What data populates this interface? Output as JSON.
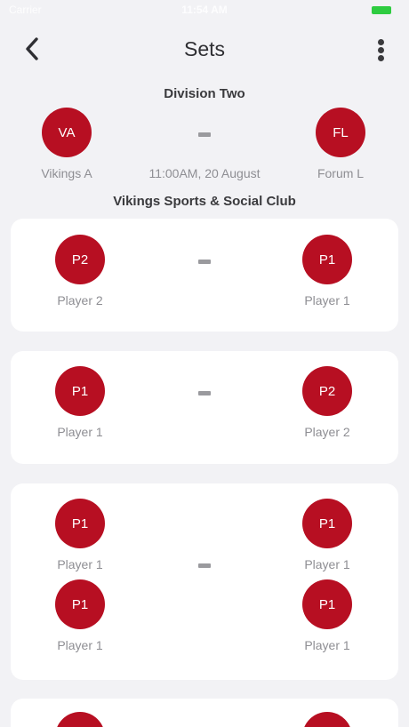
{
  "status_bar": {
    "time": "11:54 AM",
    "carrier": "Carrier"
  },
  "nav": {
    "title": "Sets",
    "back_icon": "chevron-left-icon",
    "more_icon": "more-vertical-icon"
  },
  "match": {
    "division": "Division Two",
    "home": {
      "initials": "VA",
      "name": "Vikings A"
    },
    "away": {
      "initials": "FL",
      "name": "Forum L"
    },
    "datetime": "11:00AM, 20 August",
    "venue": "Vikings Sports & Social Club"
  },
  "sets": [
    {
      "home": [
        {
          "initials": "P2",
          "name": "Player 2"
        }
      ],
      "away": [
        {
          "initials": "P1",
          "name": "Player 1"
        }
      ]
    },
    {
      "home": [
        {
          "initials": "P1",
          "name": "Player 1"
        }
      ],
      "away": [
        {
          "initials": "P2",
          "name": "Player 2"
        }
      ]
    },
    {
      "home": [
        {
          "initials": "P1",
          "name": "Player 1"
        },
        {
          "initials": "P1",
          "name": "Player 1"
        }
      ],
      "away": [
        {
          "initials": "P1",
          "name": "Player 1"
        },
        {
          "initials": "P1",
          "name": "Player 1"
        }
      ]
    }
  ],
  "colors": {
    "avatar": "#b70f22",
    "background": "#f2f2f5",
    "card": "#ffffff"
  }
}
